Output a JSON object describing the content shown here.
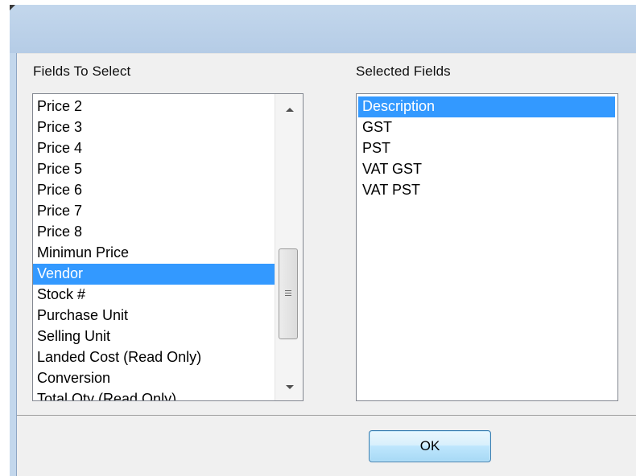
{
  "left_list": {
    "caption": "Fields To Select",
    "items": [
      "Price 2",
      "Price 3",
      "Price 4",
      "Price 5",
      "Price 6",
      "Price 7",
      "Price 8",
      "Minimun Price",
      "Vendor",
      "Stock #",
      "Purchase Unit",
      "Selling Unit",
      "Landed Cost (Read Only)",
      "Conversion",
      "Total Qty (Read Only)"
    ],
    "selected_item": "Vendor"
  },
  "right_list": {
    "caption": "Selected Fields",
    "items": [
      "Description",
      "GST",
      "PST",
      "VAT GST",
      "VAT PST"
    ],
    "selected_item": "Description"
  },
  "ok_button": {
    "label": "OK"
  },
  "colors": {
    "selection": "#3399ff",
    "title_bar": "#c3d7ec",
    "dialog_background": "#f0f0f0",
    "button_border": "#3c7fb1"
  }
}
